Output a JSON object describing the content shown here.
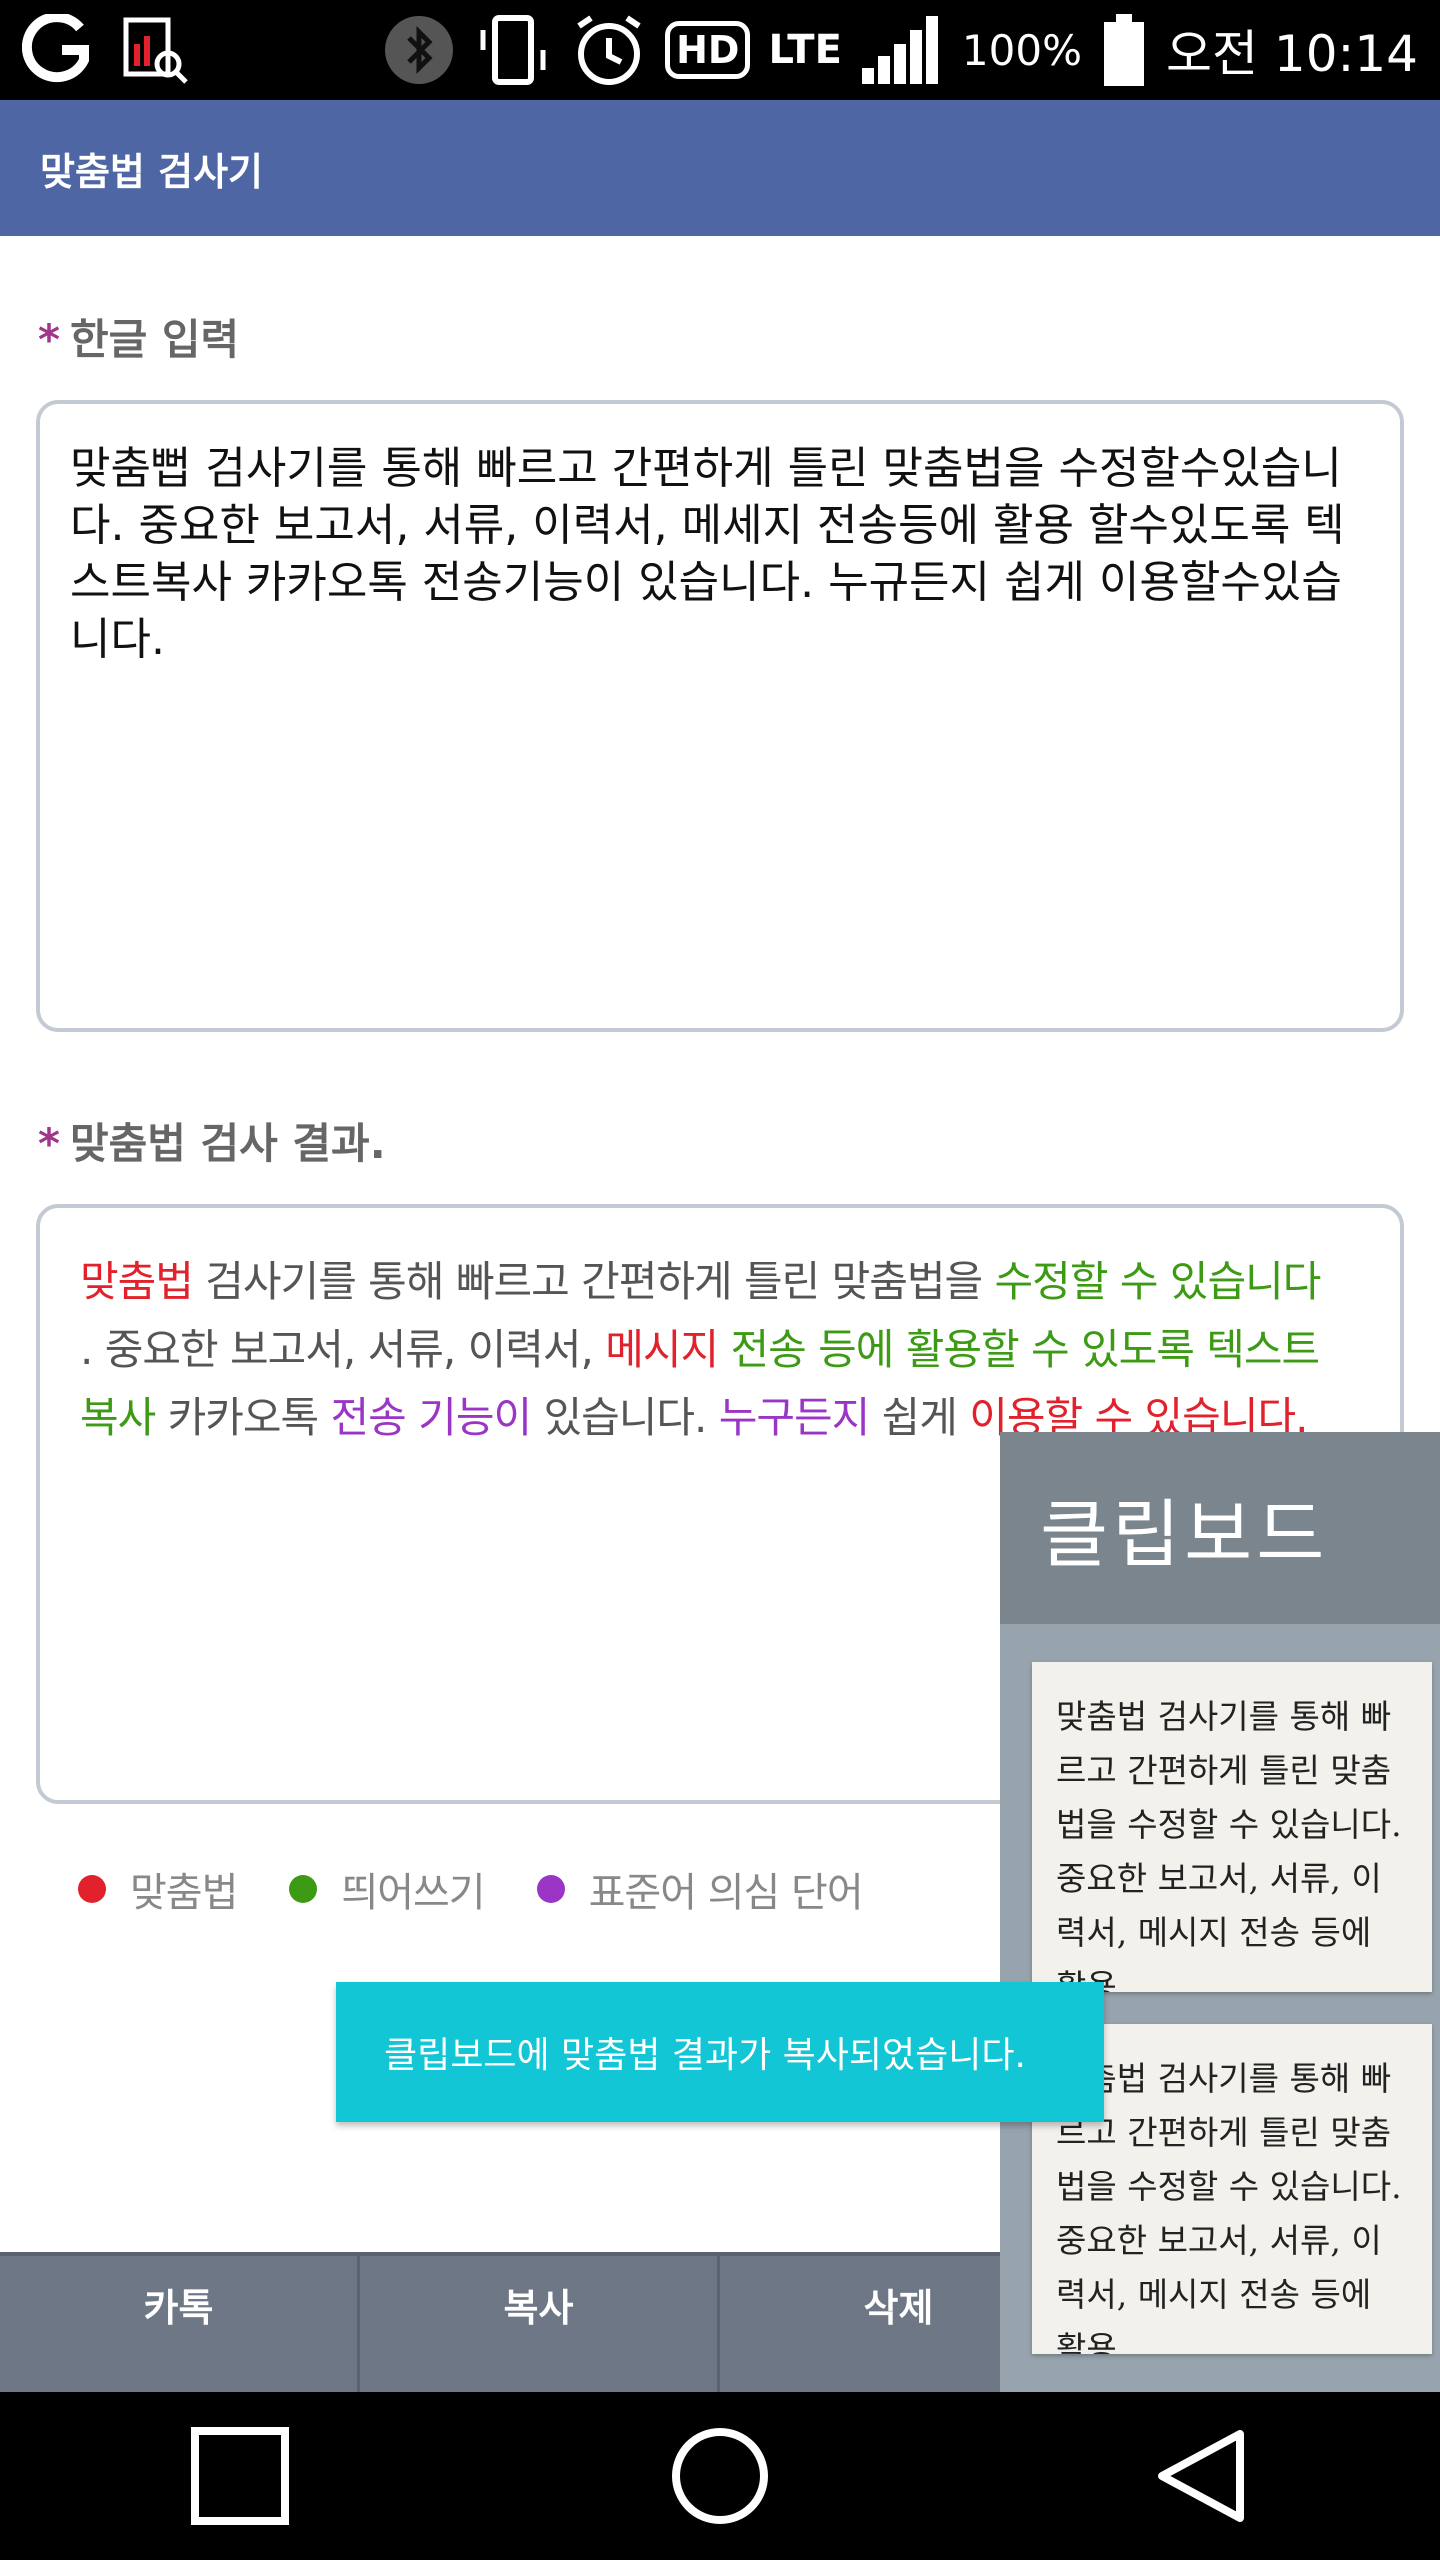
{
  "status_bar": {
    "battery": "100%",
    "lte": "LTE",
    "hd": "HD",
    "time": "오전 10:14",
    "icons": [
      "carrier-icon",
      "app-notification-icon",
      "bluetooth-icon",
      "vibrate-icon",
      "alarm-icon",
      "hd-icon",
      "lte-icon",
      "signal-icon",
      "battery-icon"
    ]
  },
  "app_bar": {
    "title": "맞춤법 검사기"
  },
  "input_section": {
    "label": "한글 입력",
    "star": "*",
    "text": "맞춤뻡 검사기를 통해 빠르고 간편하게 틀린 맞춤법을 수정할수있습니다. 중요한 보고서, 서류, 이력서, 메세지 전송등에 활용 할수있도록 텍스트복사 카카오톡 전송기능이 있습니다. 누규든지 쉽게 이용할수있습니다."
  },
  "result_section": {
    "label": "맞춤법 검사 결과.",
    "star": "*",
    "line1": [
      {
        "text": "맞춤법",
        "type": "spelling"
      },
      {
        "text": " 검사기를 통해 빠르고 간편하게 틀린 맞춤법을 ",
        "type": "normal"
      },
      {
        "text": "수정할 수 있습니다",
        "type": "spacing"
      }
    ],
    "line2": [
      {
        "text": ". 중요한 보고서, 서류, 이력서, ",
        "type": "normal"
      },
      {
        "text": "메시지",
        "type": "spelling"
      },
      {
        "text": " ",
        "type": "normal"
      },
      {
        "text": "전송 등에 활용할 수 있도록 텍스트",
        "type": "spacing"
      }
    ],
    "line3": [
      {
        "text": "복사",
        "type": "spacing"
      },
      {
        "text": " 카카오톡 ",
        "type": "normal"
      },
      {
        "text": "전송 기능이",
        "type": "standard"
      },
      {
        "text": " 있습니다. ",
        "type": "normal"
      },
      {
        "text": "누구든지",
        "type": "standard"
      },
      {
        "text": " 쉽게 ",
        "type": "normal"
      },
      {
        "text": "이용할 수 있습니다.",
        "type": "spelling"
      }
    ]
  },
  "legend": {
    "spelling": "맞춤법",
    "spacing": "띄어쓰기",
    "standard": "표준어 의심 단어"
  },
  "colors": {
    "spelling": "#e1212b",
    "spacing": "#3c9a15",
    "standard": "#9a35c5",
    "app_bar": "#4e66a3",
    "toast": "#12c6d6"
  },
  "actions": {
    "kakao": "카톡",
    "copy": "복사",
    "delete": "삭제"
  },
  "clipboard": {
    "title": "클립보드",
    "card1": "맞춤법 검사기를 통해 빠르고 간편하게 틀린 맞춤법을 수정할 수 있습니다. 중요한 보고서, 서류, 이력서, 메시지 전송 등에 활용",
    "card2": "맞춤법 검사기를 통해 빠르고 간편하게 틀린 맞춤법을 수정할 수 있습니다. 중요한 보고서, 서류, 이력서, 메시지 전송 등에 활용"
  },
  "toast": {
    "message": "클립보드에 맞춤법 결과가 복사되었습니다."
  },
  "nav": {
    "icons": [
      "recents-square-icon",
      "home-circle-icon",
      "back-triangle-icon"
    ]
  }
}
